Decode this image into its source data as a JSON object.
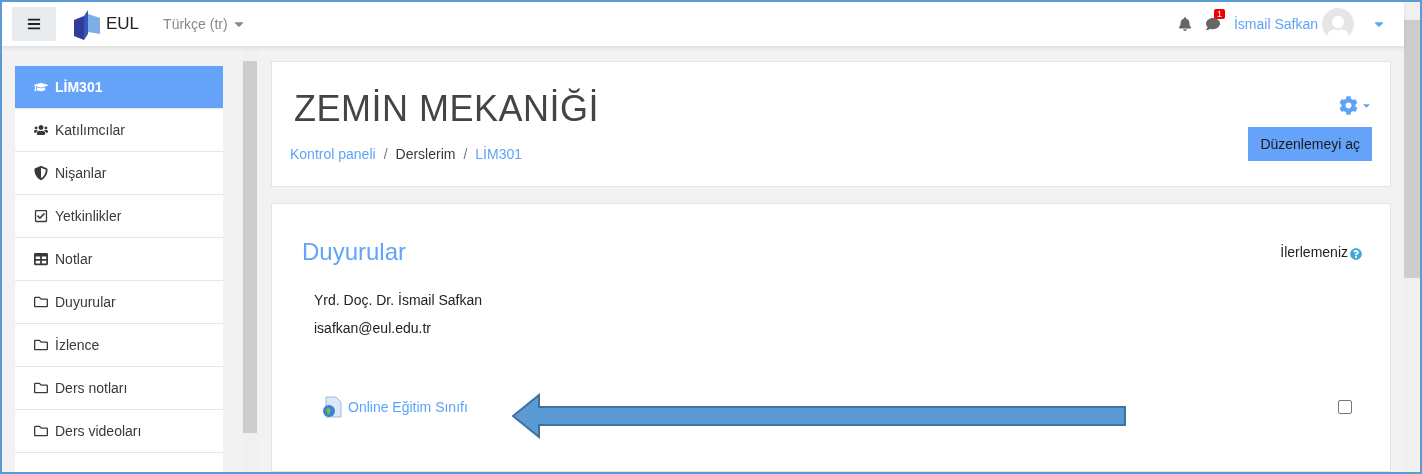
{
  "navbar": {
    "brand": "EUL",
    "language": "Türkçe (tr)",
    "notification_count": "1",
    "user_name": "İsmail Safkan"
  },
  "sidebar": {
    "items": [
      {
        "label": "LİM301",
        "kind": "course",
        "selected": true
      },
      {
        "label": "Katılımcılar",
        "kind": "participants",
        "selected": false
      },
      {
        "label": "Nişanlar",
        "kind": "badges",
        "selected": false
      },
      {
        "label": "Yetkinlikler",
        "kind": "competencies",
        "selected": false
      },
      {
        "label": "Notlar",
        "kind": "grades",
        "selected": false
      },
      {
        "label": "Duyurular",
        "kind": "section",
        "selected": false
      },
      {
        "label": "İzlence",
        "kind": "section",
        "selected": false
      },
      {
        "label": "Ders notları",
        "kind": "section",
        "selected": false
      },
      {
        "label": "Ders videoları",
        "kind": "section",
        "selected": false
      }
    ]
  },
  "header": {
    "title": "ZEMİN MEKANİĞİ",
    "separator": "/",
    "breadcrumb": [
      {
        "label": "Kontrol paneli",
        "link": true
      },
      {
        "label": "Derslerim",
        "link": false
      },
      {
        "label": "LİM301",
        "link": true
      }
    ],
    "edit_button": "Düzenlemeyi aç"
  },
  "section": {
    "title": "Duyurular",
    "progress_label": "İlerlemeniz",
    "lines": [
      "Yrd. Doç. Dr. İsmail Safkan",
      "isafkan@eul.edu.tr"
    ],
    "activities": [
      {
        "label": "Online Eğitim Sınıfı",
        "checked": false
      }
    ]
  }
}
